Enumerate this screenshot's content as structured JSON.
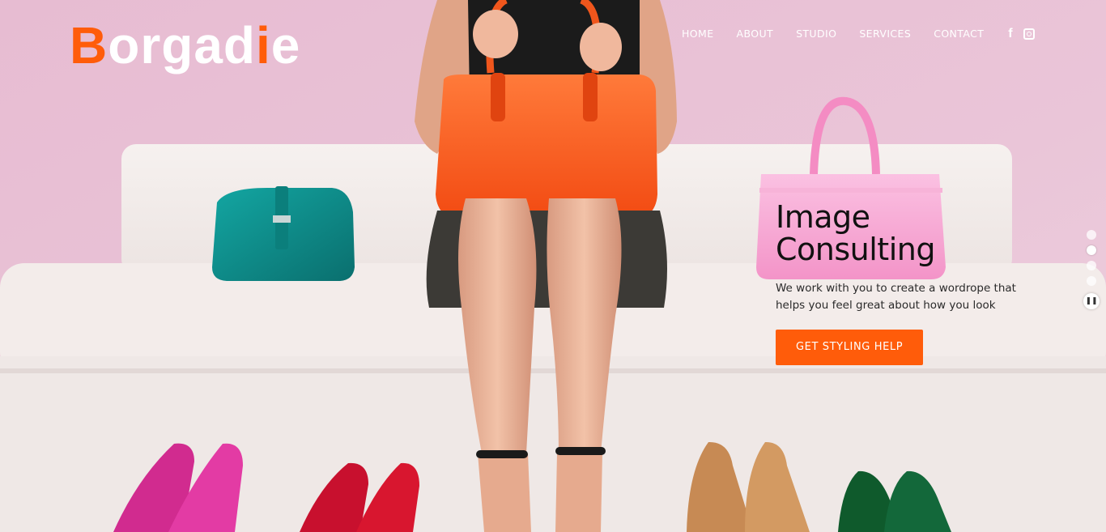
{
  "brand": {
    "name_parts": [
      {
        "text": "B",
        "accent": true
      },
      {
        "text": "orgad",
        "accent": false
      },
      {
        "text": "i",
        "accent": true
      },
      {
        "text": "e",
        "accent": false
      }
    ],
    "accent_color": "#ff5c0a"
  },
  "nav": {
    "items": [
      {
        "label": "HOME"
      },
      {
        "label": "ABOUT"
      },
      {
        "label": "STUDIO"
      },
      {
        "label": "SERVICES"
      },
      {
        "label": "CONTACT"
      }
    ],
    "social": [
      {
        "icon": "facebook-icon",
        "glyph": "f"
      },
      {
        "icon": "instagram-icon"
      }
    ]
  },
  "hero": {
    "headline_line1": "Image",
    "headline_line2": "Consulting",
    "subtext": "We work with you to create a wordrope that helps you feel great about how you look",
    "cta_label": "GET STYLING HELP",
    "background_description_colors": {
      "wall": "#e9c3d6",
      "sofa": "#f4eeec",
      "handbag_orange": "#ff5a1f",
      "handbag_teal": "#0e8c8a",
      "handbag_pink": "#f7a8d3"
    }
  },
  "slider": {
    "slide_count": 4,
    "active_index": 1,
    "pause_glyph": "❚❚"
  }
}
